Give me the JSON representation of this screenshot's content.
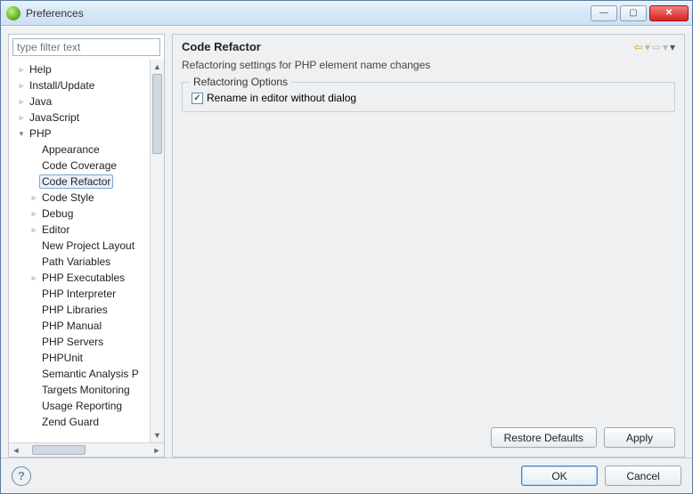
{
  "window": {
    "title": "Preferences"
  },
  "filter": {
    "placeholder": "type filter text"
  },
  "tree": [
    {
      "label": "Help",
      "level": 0,
      "expander": "closed"
    },
    {
      "label": "Install/Update",
      "level": 0,
      "expander": "closed"
    },
    {
      "label": "Java",
      "level": 0,
      "expander": "closed"
    },
    {
      "label": "JavaScript",
      "level": 0,
      "expander": "closed"
    },
    {
      "label": "PHP",
      "level": 0,
      "expander": "open"
    },
    {
      "label": "Appearance",
      "level": 1,
      "expander": "none"
    },
    {
      "label": "Code Coverage",
      "level": 1,
      "expander": "none"
    },
    {
      "label": "Code Refactor",
      "level": 1,
      "expander": "none",
      "selected": true
    },
    {
      "label": "Code Style",
      "level": 1,
      "expander": "closed"
    },
    {
      "label": "Debug",
      "level": 1,
      "expander": "closed"
    },
    {
      "label": "Editor",
      "level": 1,
      "expander": "closed"
    },
    {
      "label": "New Project Layout",
      "level": 1,
      "expander": "none"
    },
    {
      "label": "Path Variables",
      "level": 1,
      "expander": "none"
    },
    {
      "label": "PHP Executables",
      "level": 1,
      "expander": "closed"
    },
    {
      "label": "PHP Interpreter",
      "level": 1,
      "expander": "none"
    },
    {
      "label": "PHP Libraries",
      "level": 1,
      "expander": "none"
    },
    {
      "label": "PHP Manual",
      "level": 1,
      "expander": "none"
    },
    {
      "label": "PHP Servers",
      "level": 1,
      "expander": "none"
    },
    {
      "label": "PHPUnit",
      "level": 1,
      "expander": "none"
    },
    {
      "label": "Semantic Analysis P",
      "level": 1,
      "expander": "none"
    },
    {
      "label": "Targets Monitoring",
      "level": 1,
      "expander": "none"
    },
    {
      "label": "Usage Reporting",
      "level": 1,
      "expander": "none"
    },
    {
      "label": "Zend Guard",
      "level": 1,
      "expander": "none"
    }
  ],
  "page": {
    "title": "Code Refactor",
    "description": "Refactoring settings for PHP element name changes",
    "group_title": "Refactoring Options",
    "option_rename": {
      "label": "Rename in editor without dialog",
      "checked": true
    }
  },
  "buttons": {
    "restore_defaults": "Restore Defaults",
    "apply": "Apply",
    "ok": "OK",
    "cancel": "Cancel"
  }
}
